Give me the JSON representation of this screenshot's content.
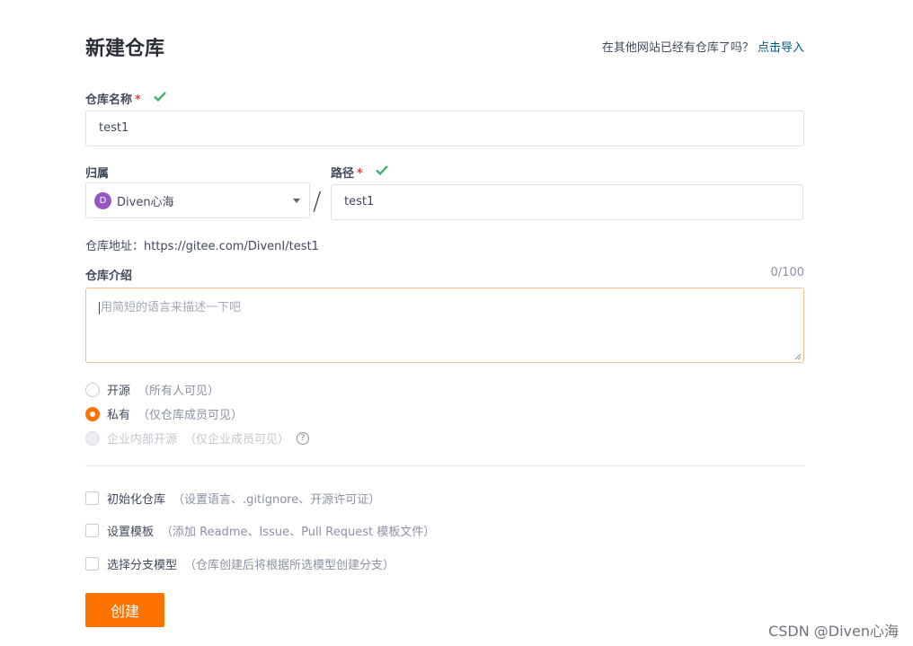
{
  "header": {
    "title": "新建仓库",
    "import_prompt": "在其他网站已经有仓库了吗？",
    "import_link": "点击导入"
  },
  "repo_name": {
    "label": "仓库名称",
    "required_mark": "*",
    "value": "test1",
    "valid_icon": "check-icon"
  },
  "owner": {
    "label": "归属",
    "avatar_letter": "D",
    "selected": "Diven心海",
    "dropdown_icon": "caret-down-icon"
  },
  "separator": "/",
  "path": {
    "label": "路径",
    "required_mark": "*",
    "value": "test1",
    "valid_icon": "check-icon"
  },
  "address": {
    "text": "仓库地址：https://gitee.com/DivenI/test1"
  },
  "description": {
    "label": "仓库介绍",
    "counter": "0/100",
    "placeholder": "用简短的语言来描述一下吧"
  },
  "visibility": {
    "options": [
      {
        "label": "开源",
        "note": "（所有人可见）",
        "selected": false,
        "disabled": false
      },
      {
        "label": "私有",
        "note": "（仅仓库成员可见）",
        "selected": true,
        "disabled": false
      },
      {
        "label": "企业内部开源",
        "note": "（仅企业成员可见）",
        "selected": false,
        "disabled": true
      }
    ],
    "help_icon": "question-circle-icon"
  },
  "options": [
    {
      "label": "初始化仓库",
      "note": "（设置语言、.gitignore、开源许可证）",
      "checked": false
    },
    {
      "label": "设置模板",
      "note": "（添加 Readme、Issue、Pull Request 模板文件）",
      "checked": false
    },
    {
      "label": "选择分支模型",
      "note": "（仓库创建后将根据所选模型创建分支）",
      "checked": false
    }
  ],
  "submit": {
    "label": "创建"
  },
  "watermark": "CSDN @Diven心海",
  "colors": {
    "accent": "#fe7300",
    "valid": "#3db36f",
    "required": "#e5463b",
    "link": "#005980",
    "avatar": "#9356c3"
  }
}
